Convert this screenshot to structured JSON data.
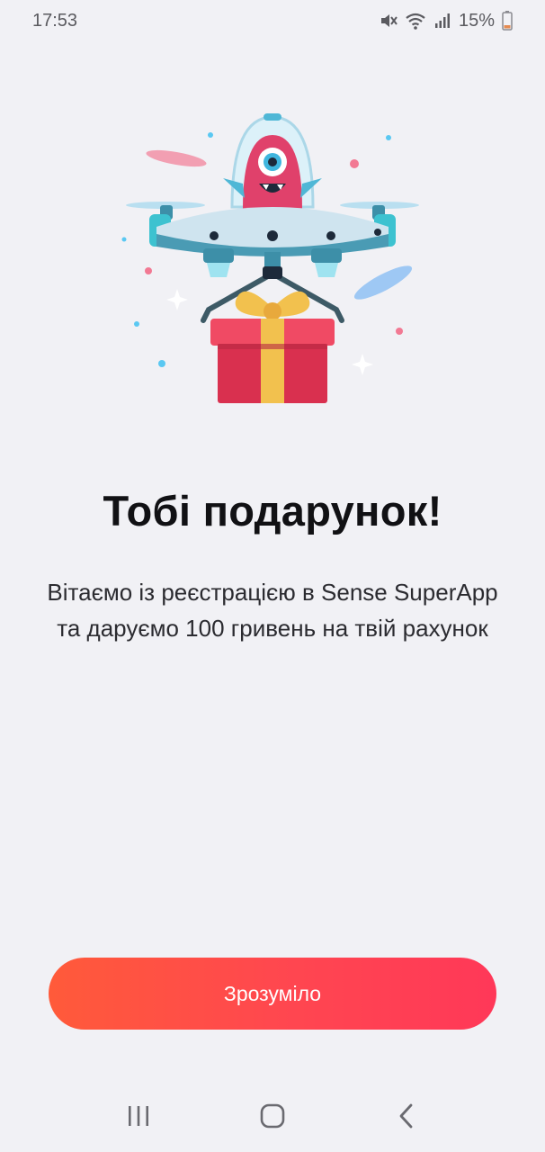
{
  "status_bar": {
    "time": "17:53",
    "battery_percent": "15%",
    "icons": [
      "mute-icon",
      "wifi-icon",
      "signal-icon",
      "battery-icon"
    ]
  },
  "illustration": {
    "icon": "drone-gift-monster-illustration"
  },
  "content": {
    "title": "Тобі подарунок!",
    "message": "Вітаємо із реєстрацією в Sense SuperApp та даруємо 100 гривень на твій рахунок"
  },
  "actions": {
    "confirm_label": "Зрозуміло"
  },
  "nav_bar": {
    "icons": [
      "recent-apps-icon",
      "home-icon",
      "back-icon"
    ]
  },
  "colors": {
    "background": "#f1f1f5",
    "accent_start": "#ff5a3a",
    "accent_end": "#ff3858"
  }
}
